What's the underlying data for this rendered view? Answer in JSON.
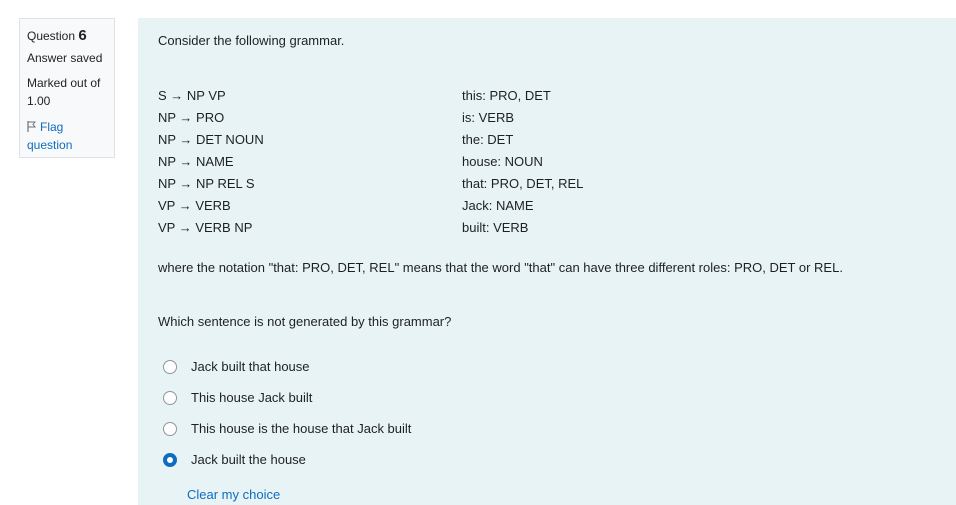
{
  "info": {
    "question_label": "Question",
    "question_number": "6",
    "state": "Answer saved",
    "grade": "Marked out of 1.00",
    "flag_label": "Flag question"
  },
  "question": {
    "intro": "Consider the following grammar.",
    "rules": [
      "S → NP VP",
      "NP → PRO",
      "NP → DET NOUN",
      "NP → NAME",
      "NP → NP REL S",
      "VP → VERB",
      "VP → VERB NP"
    ],
    "lexicon": [
      "this: PRO, DET",
      "is: VERB",
      "the: DET",
      "house: NOUN",
      "that: PRO, DET, REL",
      "Jack: NAME",
      "built: VERB"
    ],
    "note": "where the notation \"that: PRO, DET, REL\" means that the word \"that\" can have three different roles: PRO, DET or REL.",
    "prompt": "Which sentence is not generated by this grammar?",
    "answers": [
      {
        "label": "Jack built that house",
        "selected": false
      },
      {
        "label": "This house Jack built",
        "selected": false
      },
      {
        "label": "This house is the house that Jack built",
        "selected": false
      },
      {
        "label": "Jack built the house",
        "selected": true
      }
    ],
    "clear_label": "Clear my choice"
  },
  "colors": {
    "content_bg": "#e7f3f5",
    "info_bg": "#f8f9fa",
    "link": "#0f6cbf"
  }
}
